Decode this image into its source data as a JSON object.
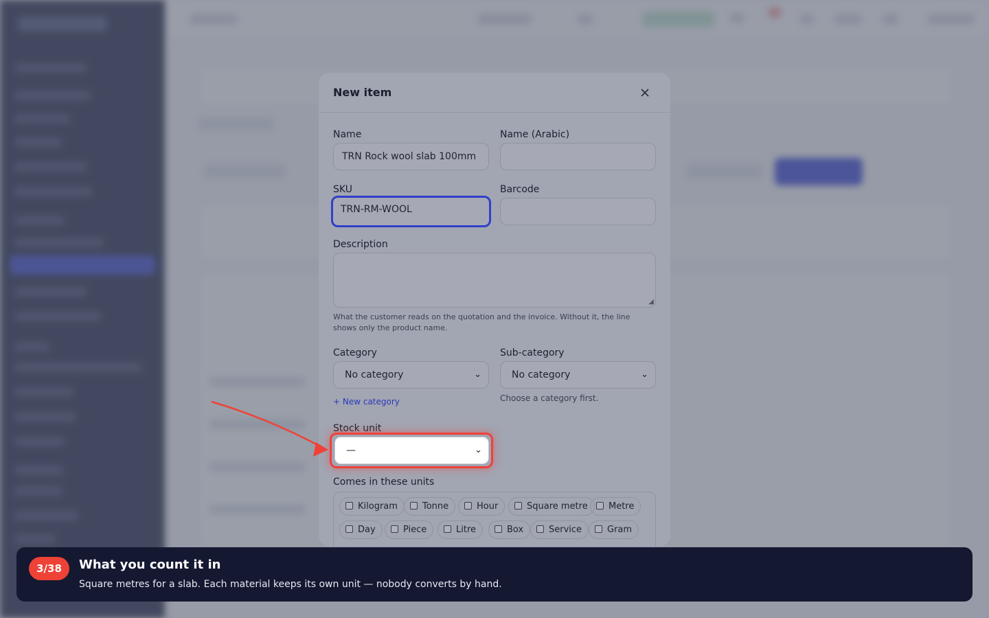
{
  "modal": {
    "title": "New item",
    "close_icon": "close-icon",
    "name_label": "Name",
    "name_value": "TRN Rock wool slab 100mm",
    "name_arabic_label": "Name (Arabic)",
    "name_arabic_value": "",
    "sku_label": "SKU",
    "sku_value": "TRN-RM-WOOL",
    "barcode_label": "Barcode",
    "barcode_value": "",
    "description_label": "Description",
    "description_value": "",
    "description_help": "What the customer reads on the quotation and the invoice. Without it, the line shows only the product name.",
    "category_label": "Category",
    "category_value": "No category",
    "new_category_link": "+ New category",
    "subcategory_label": "Sub-category",
    "subcategory_value": "No category",
    "subcategory_help": "Choose a category first.",
    "stock_unit_label": "Stock unit",
    "stock_unit_value": "—",
    "units_label": "Comes in these units",
    "units": [
      {
        "label": "Kilogram",
        "checked": false
      },
      {
        "label": "Tonne",
        "checked": false
      },
      {
        "label": "Hour",
        "checked": false
      },
      {
        "label": "Square metre",
        "checked": false
      },
      {
        "label": "Metre",
        "checked": false
      },
      {
        "label": "Day",
        "checked": false
      },
      {
        "label": "Piece",
        "checked": false
      },
      {
        "label": "Litre",
        "checked": false
      },
      {
        "label": "Box",
        "checked": false
      },
      {
        "label": "Service",
        "checked": false
      },
      {
        "label": "Gram",
        "checked": false
      }
    ]
  },
  "tour": {
    "step": "3/38",
    "title": "What you count it in",
    "text": "Square metres for a slab. Each material keeps its own unit — nobody converts by hand."
  },
  "colors": {
    "accent": "#2f40c9",
    "highlight": "#f0413a",
    "tour_bg": "#141831",
    "sidebar_bg": "#1a1f3d"
  }
}
